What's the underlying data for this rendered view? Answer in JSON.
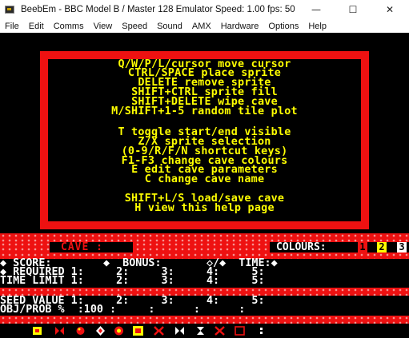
{
  "window": {
    "title": "BeebEm - BBC Model B / Master 128 Emulator  Speed: 1.00  fps: 50",
    "minimize": "—",
    "maximize": "☐",
    "close": "✕"
  },
  "menu": [
    "File",
    "Edit",
    "Comms",
    "View",
    "Speed",
    "Sound",
    "AMX",
    "Hardware",
    "Options",
    "Help"
  ],
  "help": {
    "lines": [
      "Q/W/P/L/cursor move cursor",
      "CTRL/SPACE place sprite",
      "DELETE remove sprite",
      "SHIFT+CTRL sprite fill",
      "SHIFT+DELETE wipe cave",
      "M/SHIFT+1-5 random tile plot",
      "T toggle start/end visible",
      "Z/X sprite selection",
      "(0-9/R/F/N shortcut keys)",
      "F1-F3 change cave colours",
      "E edit cave parameters",
      "C change cave name",
      "SHIFT+L/S load/save cave",
      "H view this help page"
    ]
  },
  "status": {
    "cave_label": "CAVE :",
    "colours_label": "COLOURS:",
    "colour_1": "1",
    "colour_2": "2",
    "colour_3": "3"
  },
  "params": {
    "score_row": "◆ SCORE:        ◆  BONUS:       ◇/◆  TIME:◆",
    "required_row": "◆ REQUIRED 1:     2:     3:     4:     5:",
    "time_limit_row": "TIME LIMIT 1:     2:     3:     4:     5:",
    "seed_row": "SEED VALUE 1:     2:     3:     4:     5:",
    "obj_row": "OBJ/PROB %  :100 :     :      :      :"
  },
  "colors": {
    "red": "#ee1111",
    "yellow": "#ffff00",
    "white": "#ffffff",
    "black": "#000000",
    "cyan": "#00ffff"
  },
  "sprites": [
    "firefly",
    "butterfly",
    "boulder",
    "diamond",
    "amoeba",
    "wall",
    "magic-wall",
    "exit",
    "steel",
    "dirt",
    "outbox",
    "space"
  ]
}
